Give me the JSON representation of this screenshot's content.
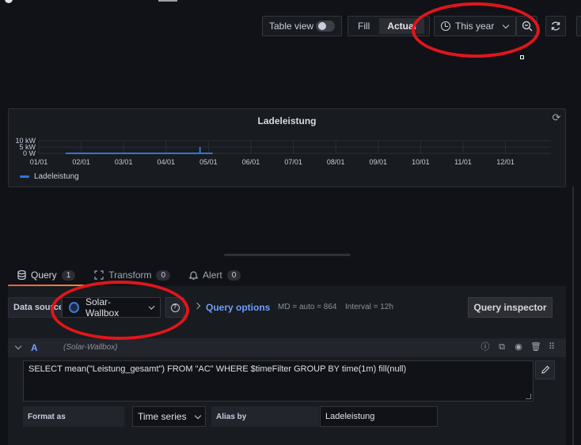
{
  "toolbar": {
    "table_view_label": "Table view",
    "fill_label": "Fill",
    "actual_label": "Actual",
    "time_range_label": "This year"
  },
  "panel": {
    "title": "Ladeleistung",
    "legend_label": "Ladeleistung"
  },
  "chart_data": {
    "type": "line",
    "title": "Ladeleistung",
    "y_ticks": [
      "10 kW",
      "5 kW",
      "0 W"
    ],
    "x_ticks": [
      "01/01",
      "02/01",
      "03/01",
      "04/01",
      "05/01",
      "06/01",
      "07/01",
      "08/01",
      "09/01",
      "10/01",
      "11/01",
      "12/01"
    ],
    "series": [
      {
        "name": "Ladeleistung",
        "color": "#3274d9",
        "x_range": [
          "01/20",
          "05/04"
        ],
        "baseline_kw": 0,
        "spike": {
          "x": "04/25",
          "value_kw": 5
        }
      }
    ],
    "ylim": [
      0,
      10
    ],
    "grid": true,
    "legend_position": "bottom-left"
  },
  "tabs": [
    {
      "label": "Query",
      "count": "1"
    },
    {
      "label": "Transform",
      "count": "0"
    },
    {
      "label": "Alert",
      "count": "0"
    }
  ],
  "datasource": {
    "label": "Data source",
    "name": "Solar-Wallbox",
    "query_options_label": "Query options",
    "md_text": "MD = auto = 864",
    "interval_text": "Interval = 12h",
    "inspector_label": "Query inspector"
  },
  "query_row": {
    "ref_id": "A",
    "datasource_hint": "(Solar-Wallbox)",
    "sql": "SELECT mean(\"Leistung_gesamt\") FROM \"AC\" WHERE $timeFilter GROUP BY time(1m) fill(null)",
    "format_label": "Format as",
    "format_value": "Time series",
    "alias_label": "Alias by",
    "alias_value": "Ladeleistung"
  },
  "colors": {
    "background": "#111217",
    "panel": "#181b1f",
    "accent_blue": "#6e9fff",
    "series_blue": "#3274d9",
    "annotation_red": "#e0161b",
    "tab_underline": "#ff8833"
  }
}
